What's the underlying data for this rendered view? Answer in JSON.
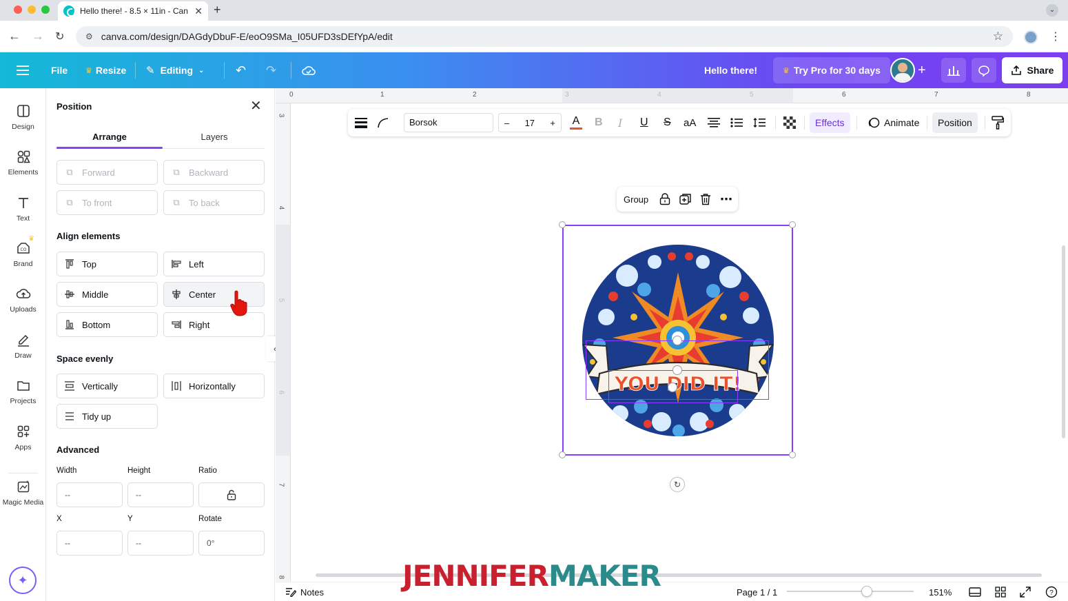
{
  "browser": {
    "tab_title": "Hello there! - 8.5 × 11in - Can",
    "url": "canva.com/design/DAGdyDbuF-E/eoO9SMa_I05UFD3sDEfYpA/edit"
  },
  "header": {
    "file": "File",
    "resize": "Resize",
    "editing": "Editing",
    "doc_title": "Hello there!",
    "try_pro": "Try Pro for 30 days",
    "share": "Share"
  },
  "rail": [
    {
      "label": "Design",
      "icon": "design-icon"
    },
    {
      "label": "Elements",
      "icon": "elements-icon"
    },
    {
      "label": "Text",
      "icon": "text-icon"
    },
    {
      "label": "Brand",
      "icon": "brand-icon"
    },
    {
      "label": "Uploads",
      "icon": "uploads-icon"
    },
    {
      "label": "Draw",
      "icon": "draw-icon"
    },
    {
      "label": "Projects",
      "icon": "projects-icon"
    },
    {
      "label": "Apps",
      "icon": "apps-icon"
    },
    {
      "label": "Magic Media",
      "icon": "magic-media-icon"
    }
  ],
  "panel": {
    "title": "Position",
    "tabs": [
      "Arrange",
      "Layers"
    ],
    "order_buttons": [
      "Forward",
      "Backward",
      "To front",
      "To back"
    ],
    "align_title": "Align elements",
    "align_buttons": [
      "Top",
      "Left",
      "Middle",
      "Center",
      "Bottom",
      "Right"
    ],
    "space_title": "Space evenly",
    "space_buttons": [
      "Vertically",
      "Horizontally",
      "Tidy up"
    ],
    "advanced_title": "Advanced",
    "fields": {
      "width_label": "Width",
      "width_value": "--",
      "height_label": "Height",
      "height_value": "--",
      "ratio_label": "Ratio",
      "x_label": "X",
      "x_value": "--",
      "y_label": "Y",
      "y_value": "--",
      "rotate_label": "Rotate",
      "rotate_value": "0°"
    }
  },
  "ruler": {
    "top": [
      "0",
      "1",
      "2",
      "3",
      "4",
      "5",
      "6",
      "7",
      "8"
    ],
    "left": [
      "3",
      "4",
      "5",
      "6",
      "7",
      "8"
    ]
  },
  "toolbar": {
    "font": "Borsok",
    "size": "17",
    "minus": "–",
    "plus": "+",
    "case": "aA",
    "effects": "Effects",
    "animate": "Animate",
    "position": "Position"
  },
  "group_bar": {
    "group": "Group"
  },
  "badge": {
    "text": "YOU DID IT!"
  },
  "bottom": {
    "notes": "Notes",
    "page": "Page 1 / 1",
    "zoom": "151%",
    "zoom_level": 0.63
  },
  "watermark": {
    "part1": "JENNIFER",
    "part2": "MAKER"
  },
  "colors": {
    "accent": "#8b3dff",
    "watermark_red": "#c8202f",
    "watermark_teal": "#2b8a8a",
    "badge_text": "#e9522c"
  }
}
